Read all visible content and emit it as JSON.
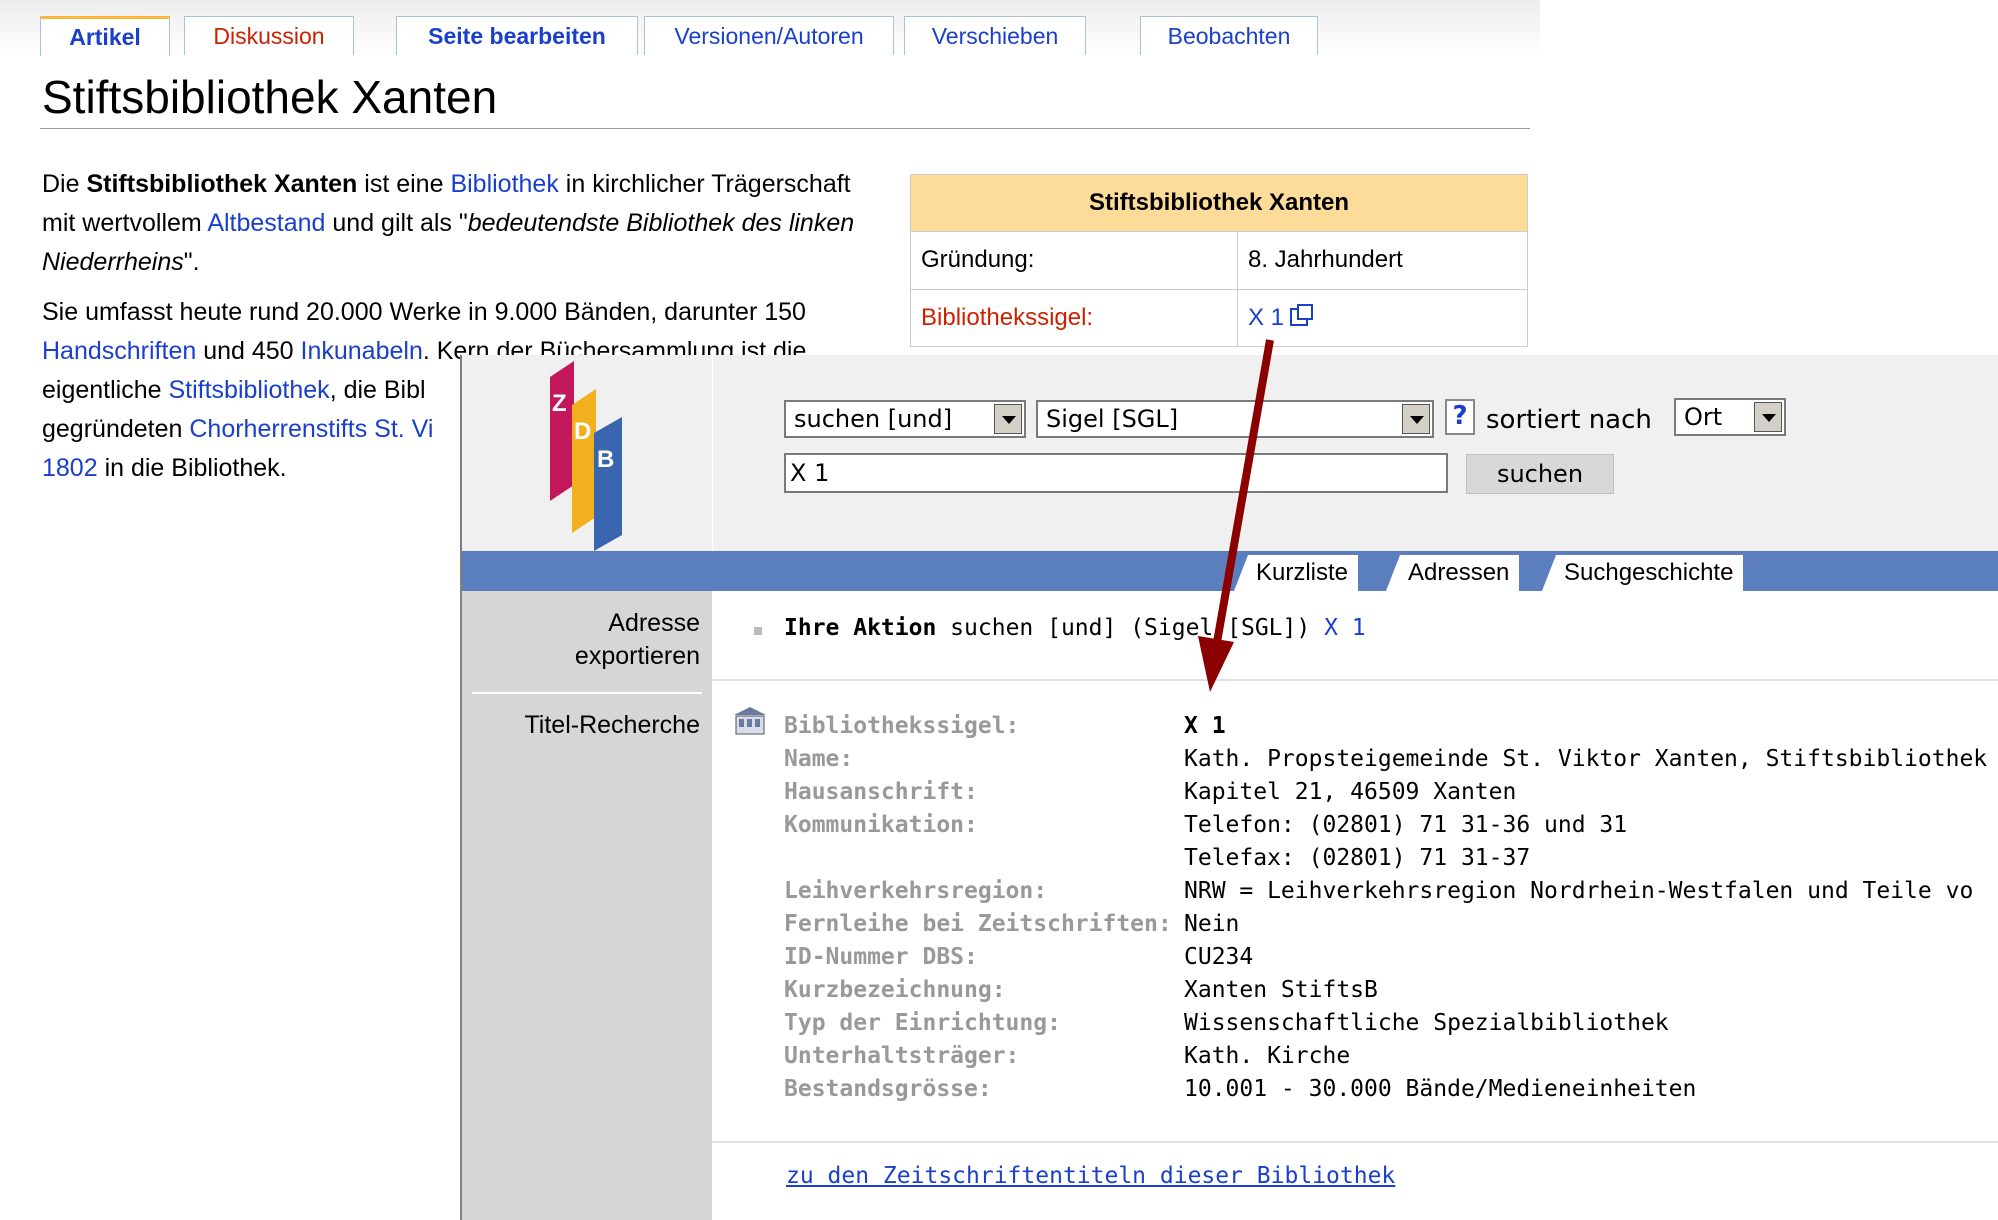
{
  "wiki": {
    "tabs": [
      {
        "label": "Artikel"
      },
      {
        "label": "Diskussion"
      },
      {
        "label": "Seite bearbeiten"
      },
      {
        "label": "Versionen/Autoren"
      },
      {
        "label": "Verschieben"
      },
      {
        "label": "Beobachten"
      }
    ],
    "title": "Stiftsbibliothek Xanten",
    "p1": {
      "t1": "Die ",
      "b1": "Stiftsbibliothek Xanten",
      "t2": " ist eine ",
      "l1": "Bibliothek",
      "t3": " in kirchlicher Trägerschaft mit wertvollem ",
      "l2": "Altbestand",
      "t4": " und gilt als \"",
      "i1": "bedeutendste Bibliothek des linken Niederrheins",
      "t5": "\"."
    },
    "p2": {
      "t1": "Sie umfasst heute rund 20.000 Werke in 9.000 Bänden, darunter 150 ",
      "l1": "Handschriften",
      "t2": " und 450 ",
      "l2": "Inkunabeln",
      "t3": ". Kern der Büchersammlung ist die eigentliche ",
      "l3": "Stiftsbibliothek",
      "t4": ", die Bibl",
      "t5": "gegründeten ",
      "l4": "Chorherrenstifts St. Vi",
      "l5": "1802",
      "t6": " in die Bibliothek."
    },
    "infobox": {
      "title": "Stiftsbibliothek Xanten",
      "row1_label": "Gründung:",
      "row1_value": "8. Jahrhundert",
      "row2_label": "Bibliothekssigel:",
      "row2_value": "X 1"
    }
  },
  "zdb": {
    "logo_letters": [
      "Z",
      "D",
      "B"
    ],
    "search": {
      "op_select": "suchen [und]",
      "field_select": "Sigel [SGL]",
      "help": "?",
      "sort_label": "sortiert nach",
      "sort_select": "Ort",
      "query": "X 1",
      "search_button": "suchen"
    },
    "tabs": [
      "Kurzliste",
      "Adressen",
      "Suchgeschichte"
    ],
    "sidebar": {
      "export_line1": "Adresse",
      "export_line2": "exportieren",
      "title_search": "Titel-Recherche"
    },
    "action": {
      "bold": "Ihre Aktion",
      "text": " suchen [und] (Sigel [SGL]) ",
      "link": "X 1"
    },
    "record": [
      {
        "label": "Bibliothekssigel:",
        "value": "X 1"
      },
      {
        "label": "Name:",
        "value": "Kath. Propsteigemeinde St. Viktor Xanten, Stiftsbibliothek"
      },
      {
        "label": "Hausanschrift:",
        "value": "Kapitel 21, 46509 Xanten"
      },
      {
        "label": "Kommunikation:",
        "value": "Telefon: (02801) 71 31-36 und 31"
      },
      {
        "label": "",
        "value": "Telefax: (02801) 71 31-37"
      },
      {
        "label": "Leihverkehrsregion:",
        "value": "NRW = Leihverkehrsregion Nordrhein-Westfalen und Teile vo"
      },
      {
        "label": "Fernleihe bei Zeitschriften:",
        "value": "Nein"
      },
      {
        "label": "ID-Nummer DBS:",
        "value": "CU234"
      },
      {
        "label": "Kurzbezeichnung:",
        "value": "Xanten StiftsB"
      },
      {
        "label": "Typ der Einrichtung:",
        "value": "Wissenschaftliche Spezialbibliothek"
      },
      {
        "label": "Unterhaltsträger:",
        "value": "Kath. Kirche"
      },
      {
        "label": "Bestandsgrösse:",
        "value": "10.001 - 30.000 Bände/Medieneinheiten"
      }
    ],
    "journals_link": "zu den Zeitschriftentiteln dieser Bibliothek"
  },
  "colors": {
    "arrow": "#8b0000",
    "logo_magenta": "#c2185b",
    "logo_yellow": "#f2b01e",
    "logo_blue": "#3a66b0",
    "bluebar": "#5b7fbe"
  }
}
